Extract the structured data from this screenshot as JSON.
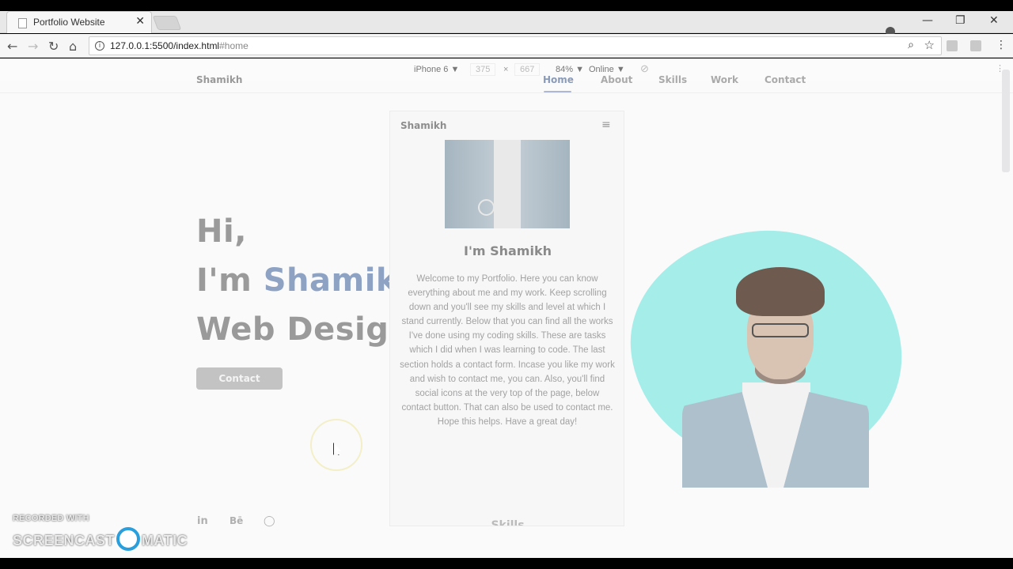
{
  "browser": {
    "tab_title": "Portfolio Website",
    "tab_close": "✕",
    "url_base": "127.0.0.1:5500/index.html",
    "url_hash": "#home",
    "win_min": "—",
    "win_max": "❐",
    "win_close": "✕"
  },
  "devtools": {
    "device": "iPhone 6 ▼",
    "width": "375",
    "times": "×",
    "height": "667",
    "zoom": "84% ▼",
    "network": "Online ▼"
  },
  "site": {
    "logo": "Shamikh",
    "nav": [
      "Home",
      "About",
      "Skills",
      "Work",
      "Contact"
    ],
    "hero": {
      "line1": "Hi,",
      "line2_prefix": "I'm ",
      "line2_name": "Shamikh",
      "line3": "Web Designer",
      "button": "Contact"
    },
    "social": [
      "in",
      "Bē",
      "◯"
    ]
  },
  "phone": {
    "logo": "Shamikh",
    "menu_icon": "≡",
    "heading": "I'm Shamikh",
    "body": "Welcome to my Portfolio. Here you can know everything about me and my work. Keep scrolling down and you'll see my skills and level at which I stand currently. Below that you can find all the works I've done using my coding skills. These are tasks which I did when I was learning to code. The last section holds a contact form. Incase you like my work and wish to contact me, you can. Also, you'll find social icons at the very top of the page, below contact button. That can also be used to contact me. Hope this helps. Have a great day!",
    "next_section": "Skills"
  },
  "watermark": {
    "line1": "RECORDED WITH",
    "left": "SCREENCAST",
    "right": "MATIC"
  },
  "colors": {
    "blob": "#a5ede9",
    "accent": "#8ea3c4"
  }
}
